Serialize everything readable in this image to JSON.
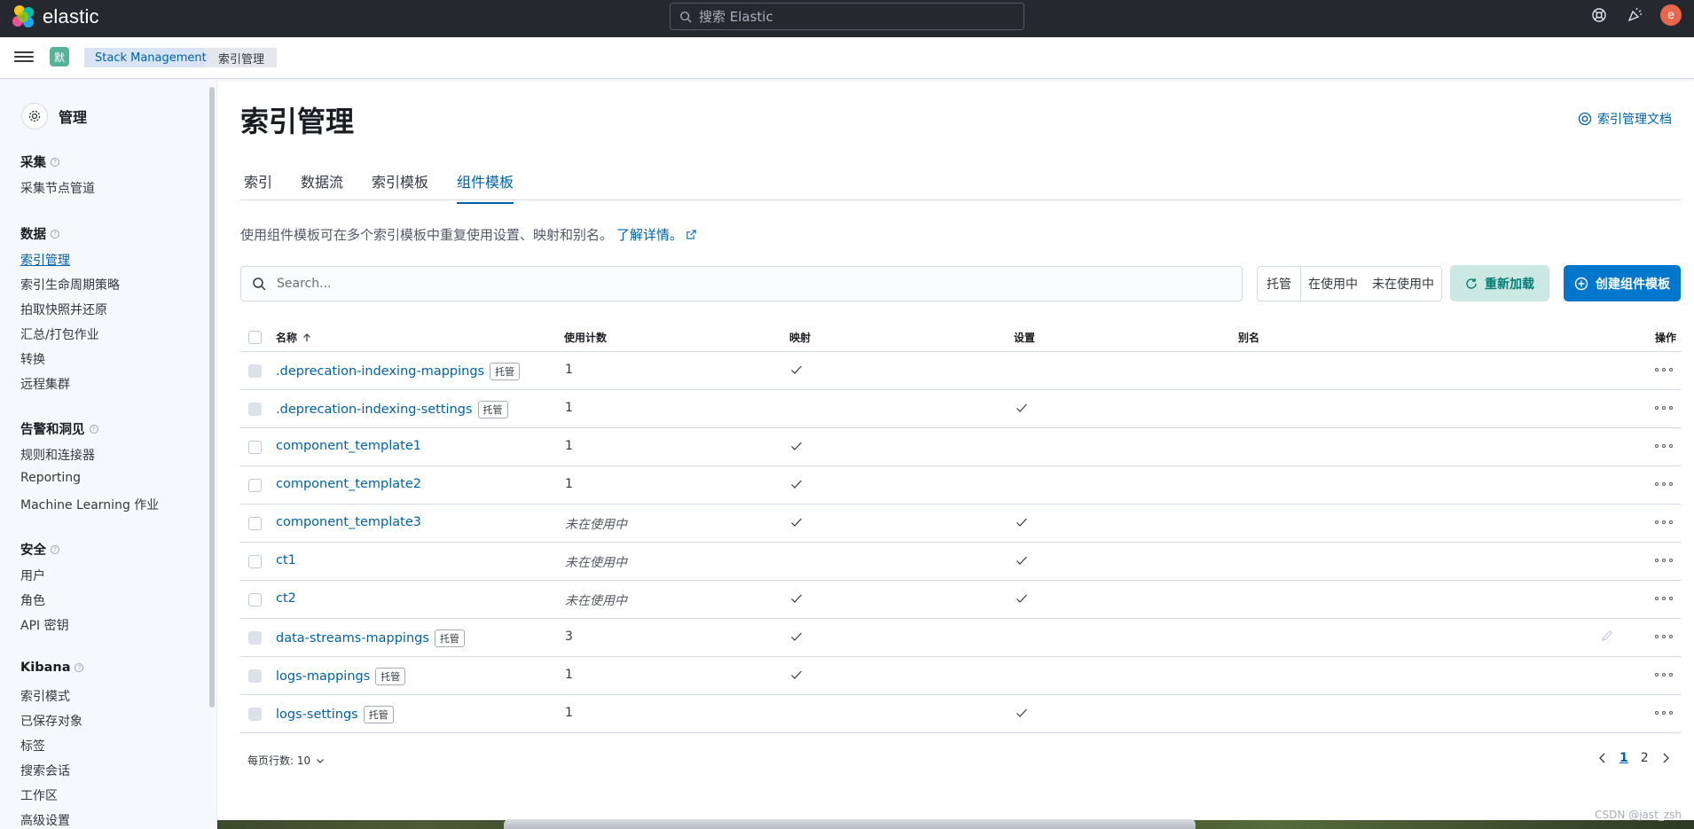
{
  "header": {
    "brand": "elastic",
    "search_placeholder": "搜索 Elastic",
    "avatar_initial": "e",
    "avatar_color": "#e7664c"
  },
  "breadcrumb": {
    "space_initial": "默",
    "items": [
      "Stack Management",
      "索引管理"
    ]
  },
  "sidebar": {
    "title": "管理",
    "sections": [
      {
        "title": "采集",
        "items": [
          "采集节点管道"
        ]
      },
      {
        "title": "数据",
        "items": [
          "索引管理",
          "索引生命周期策略",
          "拍取快照并还原",
          "汇总/打包作业",
          "转换",
          "远程集群"
        ]
      },
      {
        "title": "告警和洞见",
        "items": [
          "规则和连接器",
          "Reporting",
          "Machine Learning 作业"
        ]
      },
      {
        "title": "安全",
        "items": [
          "用户",
          "角色",
          "API 密钥"
        ]
      },
      {
        "title": "Kibana",
        "items": [
          "索引模式",
          "已保存对象",
          "标签",
          "搜索会话",
          "工作区",
          "高级设置"
        ]
      }
    ],
    "active_item": "索引管理"
  },
  "main": {
    "title": "索引管理",
    "doc_link": "索引管理文档",
    "tabs": [
      "索引",
      "数据流",
      "索引模板",
      "组件模板"
    ],
    "active_tab": "组件模板",
    "description": "使用组件模板可在多个索引模板中重复使用设置、映射和别名。",
    "learn_more": "了解详情。",
    "search_placeholder": "Search...",
    "filters": [
      "托管",
      "在使用中",
      "未在使用中"
    ],
    "reload_label": "重新加载",
    "create_label": "创建组件模板"
  },
  "table": {
    "columns": [
      "名称",
      "使用计数",
      "映射",
      "设置",
      "别名",
      "操作"
    ],
    "rows": [
      {
        "name": ".deprecation-indexing-mappings",
        "managed": "托管",
        "usage": "1",
        "mappings": true,
        "settings": false,
        "aliases": false
      },
      {
        "name": ".deprecation-indexing-settings",
        "managed": "托管",
        "usage": "1",
        "mappings": false,
        "settings": true,
        "aliases": false
      },
      {
        "name": "component_template1",
        "managed": "",
        "usage": "1",
        "mappings": true,
        "settings": false,
        "aliases": false
      },
      {
        "name": "component_template2",
        "managed": "",
        "usage": "1",
        "mappings": true,
        "settings": false,
        "aliases": false
      },
      {
        "name": "component_template3",
        "managed": "",
        "usage": "未在使用中",
        "mappings": true,
        "settings": true,
        "aliases": false
      },
      {
        "name": "ct1",
        "managed": "",
        "usage": "未在使用中",
        "mappings": false,
        "settings": true,
        "aliases": false
      },
      {
        "name": "ct2",
        "managed": "",
        "usage": "未在使用中",
        "mappings": true,
        "settings": true,
        "aliases": false
      },
      {
        "name": "data-streams-mappings",
        "managed": "托管",
        "usage": "3",
        "mappings": true,
        "settings": false,
        "aliases": false
      },
      {
        "name": "logs-mappings",
        "managed": "托管",
        "usage": "1",
        "mappings": true,
        "settings": false,
        "aliases": false
      },
      {
        "name": "logs-settings",
        "managed": "托管",
        "usage": "1",
        "mappings": false,
        "settings": true,
        "aliases": false
      }
    ]
  },
  "pagination": {
    "rows_per_page": "每页行数: 10",
    "pages": [
      "1",
      "2"
    ],
    "current_page": "1"
  },
  "watermark": "CSDN @jast_zsh"
}
